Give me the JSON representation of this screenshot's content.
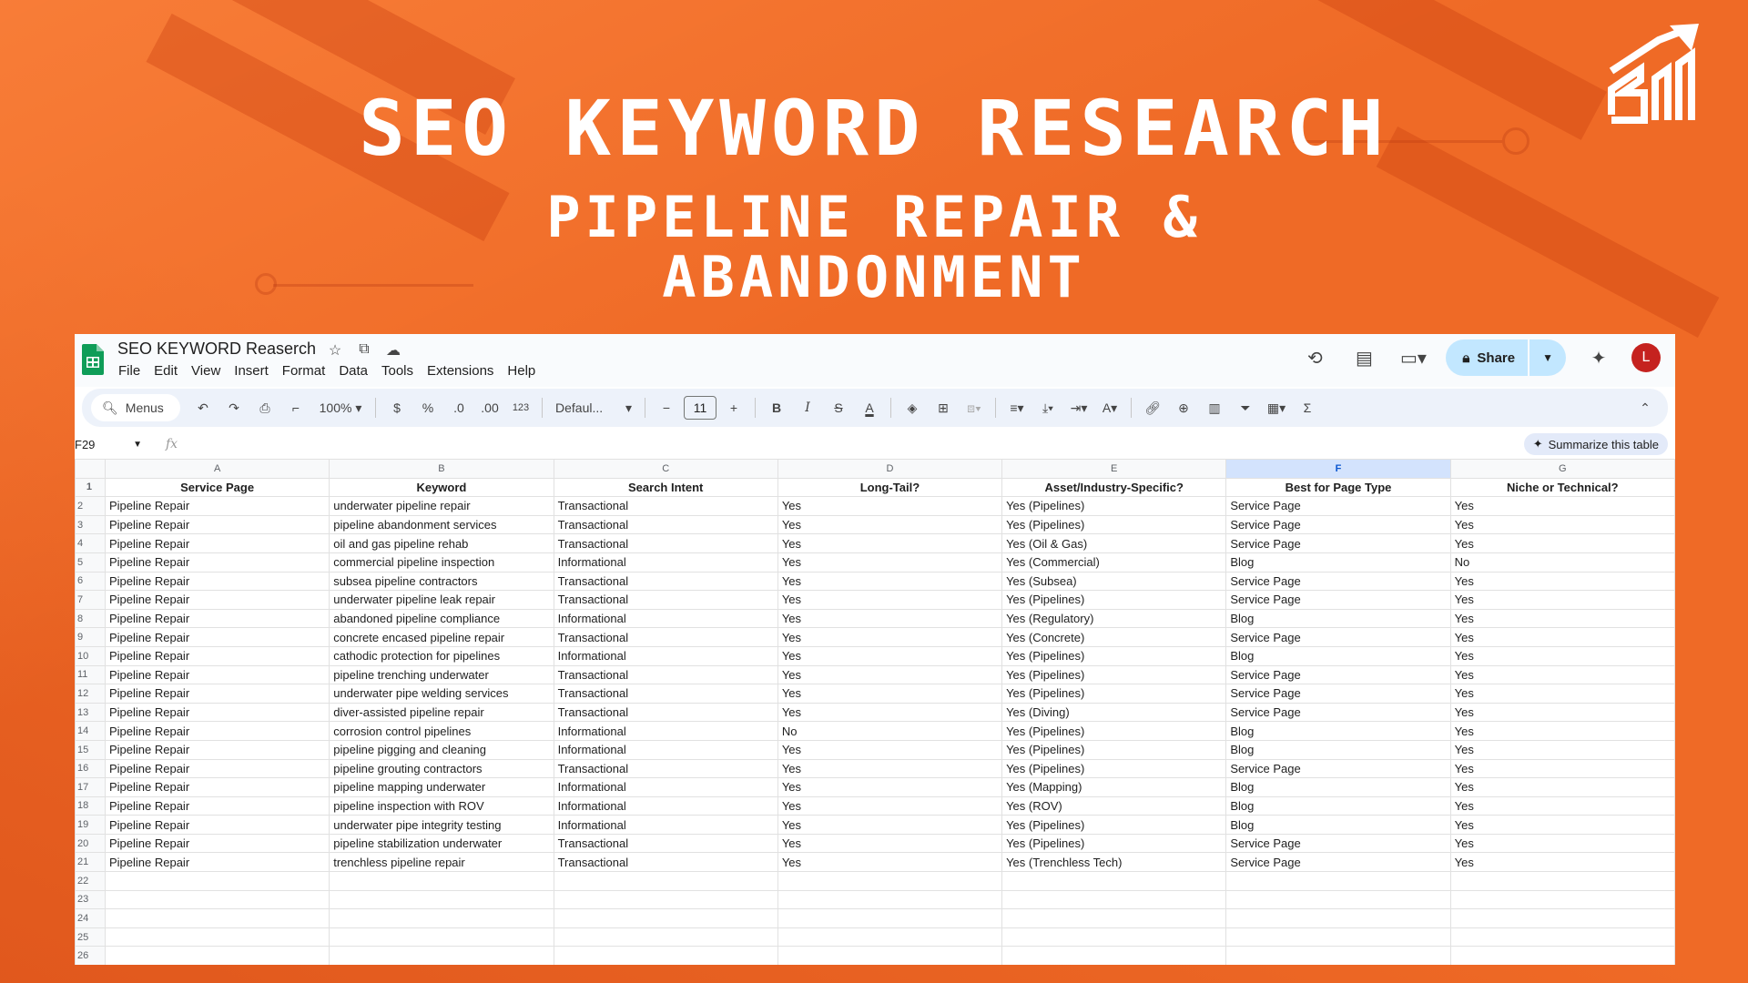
{
  "hero": {
    "title": "SEO KEYWORD RESEARCH",
    "subtitle_line1": "PIPELINE REPAIR &",
    "subtitle_line2": "ABANDONMENT"
  },
  "sheets": {
    "doc_title": "SEO KEYWORD Reaserch",
    "menu": [
      "File",
      "Edit",
      "View",
      "Insert",
      "Format",
      "Data",
      "Tools",
      "Extensions",
      "Help"
    ],
    "share_label": "Share",
    "avatar_initial": "L",
    "toolbar": {
      "menus_label": "Menus",
      "zoom": "100%",
      "currency": "$",
      "percent": "%",
      "dec_decrease": ".0",
      "dec_increase": ".00",
      "number_format": "123",
      "font": "Defaul...",
      "font_size": "11",
      "bold": "B",
      "italic": "I",
      "strike": "S",
      "text_color": "A",
      "sigma": "Σ"
    },
    "name_box": "F29",
    "fx": "fx",
    "summarize_label": "Summarize this table",
    "columns": [
      "A",
      "B",
      "C",
      "D",
      "E",
      "F",
      "G"
    ],
    "selected_column": "F",
    "header_row": [
      "Service Page",
      "Keyword",
      "Search Intent",
      "Long-Tail?",
      "Asset/Industry-Specific?",
      "Best for Page Type",
      "Niche or Technical?"
    ],
    "rows": [
      [
        "Pipeline Repair",
        "underwater pipeline repair",
        "Transactional",
        "Yes",
        "Yes (Pipelines)",
        "Service Page",
        "Yes"
      ],
      [
        "Pipeline Repair",
        "pipeline abandonment services",
        "Transactional",
        "Yes",
        "Yes (Pipelines)",
        "Service Page",
        "Yes"
      ],
      [
        "Pipeline Repair",
        "oil and gas pipeline rehab",
        "Transactional",
        "Yes",
        "Yes (Oil & Gas)",
        "Service Page",
        "Yes"
      ],
      [
        "Pipeline Repair",
        "commercial pipeline inspection",
        "Informational",
        "Yes",
        "Yes (Commercial)",
        "Blog",
        "No"
      ],
      [
        "Pipeline Repair",
        "subsea pipeline contractors",
        "Transactional",
        "Yes",
        "Yes (Subsea)",
        "Service Page",
        "Yes"
      ],
      [
        "Pipeline Repair",
        "underwater pipeline leak repair",
        "Transactional",
        "Yes",
        "Yes (Pipelines)",
        "Service Page",
        "Yes"
      ],
      [
        "Pipeline Repair",
        "abandoned pipeline compliance",
        "Informational",
        "Yes",
        "Yes (Regulatory)",
        "Blog",
        "Yes"
      ],
      [
        "Pipeline Repair",
        "concrete encased pipeline repair",
        "Transactional",
        "Yes",
        "Yes (Concrete)",
        "Service Page",
        "Yes"
      ],
      [
        "Pipeline Repair",
        "cathodic protection for pipelines",
        "Informational",
        "Yes",
        "Yes (Pipelines)",
        "Blog",
        "Yes"
      ],
      [
        "Pipeline Repair",
        "pipeline trenching underwater",
        "Transactional",
        "Yes",
        "Yes (Pipelines)",
        "Service Page",
        "Yes"
      ],
      [
        "Pipeline Repair",
        "underwater pipe welding services",
        "Transactional",
        "Yes",
        "Yes (Pipelines)",
        "Service Page",
        "Yes"
      ],
      [
        "Pipeline Repair",
        "diver-assisted pipeline repair",
        "Transactional",
        "Yes",
        "Yes (Diving)",
        "Service Page",
        "Yes"
      ],
      [
        "Pipeline Repair",
        "corrosion control pipelines",
        "Informational",
        "No",
        "Yes (Pipelines)",
        "Blog",
        "Yes"
      ],
      [
        "Pipeline Repair",
        "pipeline pigging and cleaning",
        "Informational",
        "Yes",
        "Yes (Pipelines)",
        "Blog",
        "Yes"
      ],
      [
        "Pipeline Repair",
        "pipeline grouting contractors",
        "Transactional",
        "Yes",
        "Yes (Pipelines)",
        "Service Page",
        "Yes"
      ],
      [
        "Pipeline Repair",
        "pipeline mapping underwater",
        "Informational",
        "Yes",
        "Yes (Mapping)",
        "Blog",
        "Yes"
      ],
      [
        "Pipeline Repair",
        "pipeline inspection with ROV",
        "Informational",
        "Yes",
        "Yes (ROV)",
        "Blog",
        "Yes"
      ],
      [
        "Pipeline Repair",
        "underwater pipe integrity testing",
        "Informational",
        "Yes",
        "Yes (Pipelines)",
        "Blog",
        "Yes"
      ],
      [
        "Pipeline Repair",
        "pipeline stabilization underwater",
        "Transactional",
        "Yes",
        "Yes (Pipelines)",
        "Service Page",
        "Yes"
      ],
      [
        "Pipeline Repair",
        "trenchless pipeline repair",
        "Transactional",
        "Yes",
        "Yes (Trenchless Tech)",
        "Service Page",
        "Yes"
      ]
    ],
    "empty_row_numbers": [
      "22",
      "23",
      "24",
      "25",
      "26"
    ],
    "colors": {
      "accent": "#ef6a26",
      "sheets_green": "#0f9d58",
      "share_bg": "#c2e7ff",
      "avatar": "#c5221f"
    }
  }
}
